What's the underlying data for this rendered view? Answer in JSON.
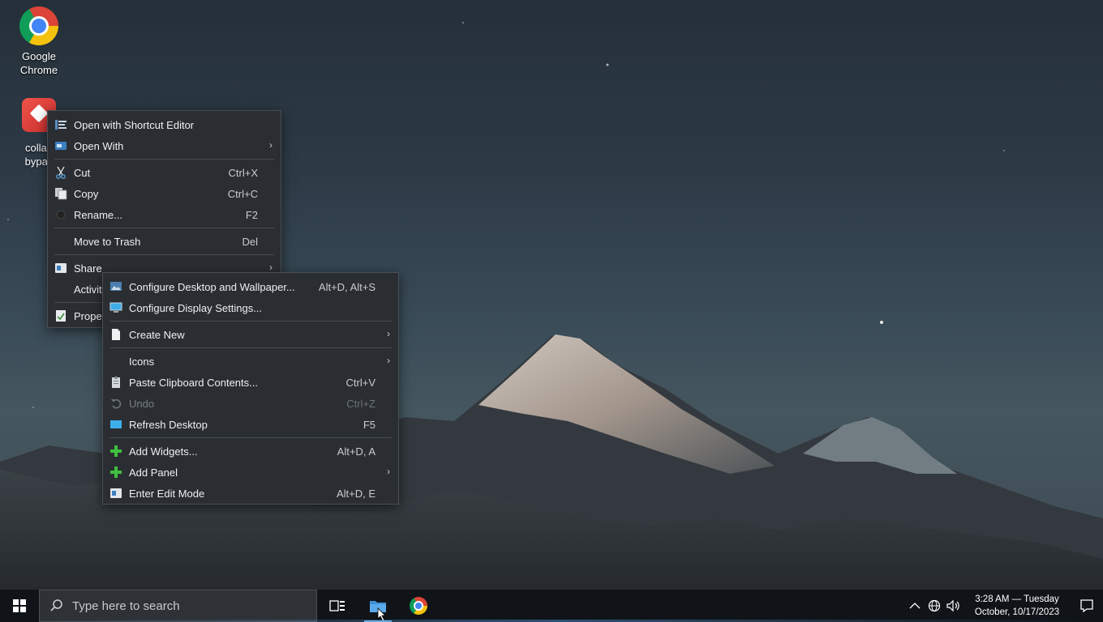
{
  "desktop": {
    "icons": [
      {
        "label_line1": "Google",
        "label_line2": "Chrome"
      },
      {
        "label_line1": "collab",
        "label_line2": "bypas"
      }
    ]
  },
  "file_menu": {
    "items": [
      {
        "label": "Open with Shortcut Editor",
        "shortcut": "",
        "icon": "shortcut-editor-icon"
      },
      {
        "label": "Open With",
        "shortcut": "",
        "icon": "open-with-icon",
        "submenu": true
      },
      {
        "label": "Cut",
        "shortcut": "Ctrl+X",
        "icon": "scissors-icon"
      },
      {
        "label": "Copy",
        "shortcut": "Ctrl+C",
        "icon": "copy-icon"
      },
      {
        "label": "Rename...",
        "shortcut": "F2",
        "icon": "rename-icon"
      },
      {
        "label": "Move to Trash",
        "shortcut": "Del",
        "icon": ""
      },
      {
        "label": "Share",
        "shortcut": "",
        "icon": "share-icon",
        "submenu": true
      },
      {
        "label": "Activit",
        "shortcut": "",
        "icon": ""
      },
      {
        "label": "Prope",
        "shortcut": "",
        "icon": "properties-icon"
      }
    ]
  },
  "desktop_menu": {
    "items": [
      {
        "label": "Configure Desktop and Wallpaper...",
        "shortcut": "Alt+D, Alt+S",
        "icon": "wallpaper-icon"
      },
      {
        "label": "Configure Display Settings...",
        "shortcut": "",
        "icon": "display-icon"
      },
      {
        "label": "Create New",
        "shortcut": "",
        "icon": "new-document-icon",
        "submenu": true
      },
      {
        "label": "Icons",
        "shortcut": "",
        "icon": "",
        "submenu": true
      },
      {
        "label": "Paste Clipboard Contents...",
        "shortcut": "Ctrl+V",
        "icon": "clipboard-icon"
      },
      {
        "label": "Undo",
        "shortcut": "Ctrl+Z",
        "icon": "undo-icon",
        "disabled": true
      },
      {
        "label": "Refresh Desktop",
        "shortcut": "F5",
        "icon": "refresh-desktop-icon"
      },
      {
        "label": "Add Widgets...",
        "shortcut": "Alt+D, A",
        "icon": "plus-icon"
      },
      {
        "label": "Add Panel",
        "shortcut": "",
        "icon": "plus-icon",
        "submenu": true
      },
      {
        "label": "Enter Edit Mode",
        "shortcut": "Alt+D, E",
        "icon": "edit-mode-icon"
      }
    ]
  },
  "taskbar": {
    "search_placeholder": "Type here to search",
    "clock_time": "3:28 AM — Tuesday",
    "clock_date": "October, 10/17/2023"
  },
  "colors": {
    "menu_bg": "#2a2e32",
    "taskbar_bg": "#101418",
    "accent": "#3daee9"
  }
}
